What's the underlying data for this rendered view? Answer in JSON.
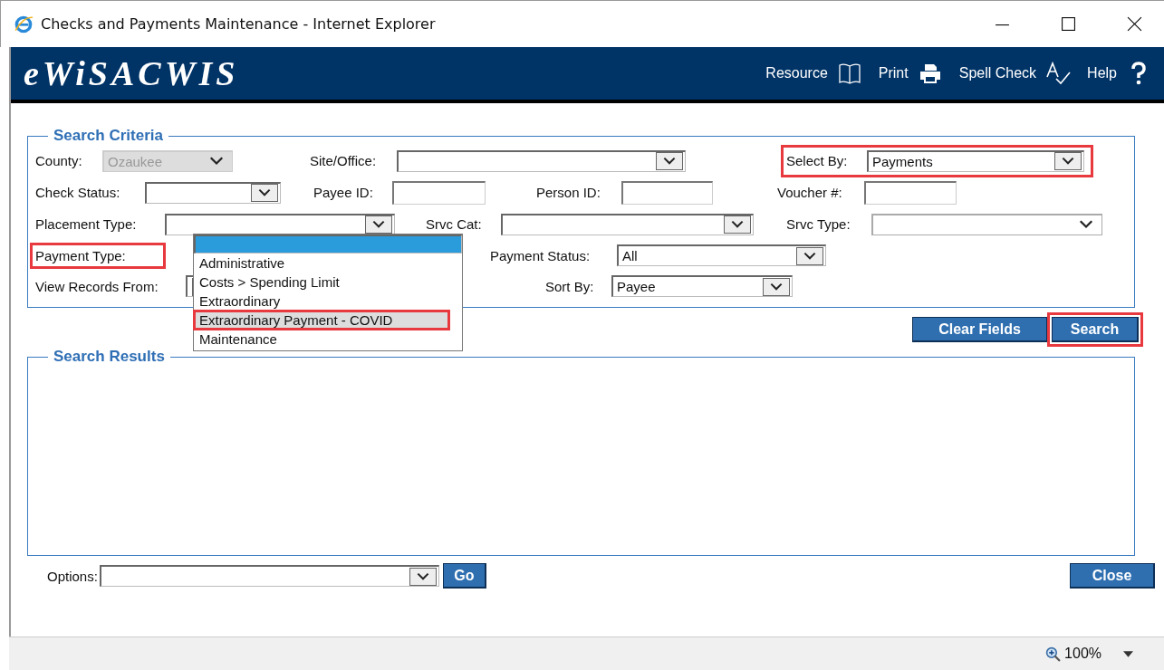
{
  "window": {
    "title": "Checks and Payments Maintenance - Internet Explorer"
  },
  "app": {
    "logo": "eWiSACWIS",
    "nav": [
      {
        "label": "Resource"
      },
      {
        "label": "Print"
      },
      {
        "label": "Spell Check"
      },
      {
        "label": "Help"
      }
    ]
  },
  "search_criteria": {
    "legend": "Search Criteria",
    "rows": [
      [
        {
          "label": "County:",
          "kind": "select",
          "value": "Ozaukee",
          "disabled": true,
          "highlighted": false
        },
        {
          "label": "Site/Office:",
          "kind": "select",
          "highlighted": false
        },
        {
          "label": "Select By:",
          "kind": "select",
          "value": "Payments",
          "highlighted": true
        }
      ],
      [
        {
          "label": "Check Status:",
          "kind": "select",
          "highlighted": false
        },
        {
          "label": "Payee ID:",
          "kind": "text",
          "highlighted": false
        },
        {
          "label": "Person ID:",
          "kind": "text",
          "highlighted": false
        },
        {
          "label": "Voucher #:",
          "kind": "text",
          "highlighted": false
        }
      ],
      [
        {
          "label": "Placement Type:",
          "kind": "select",
          "highlighted": false
        },
        {
          "label": "Srvc Cat:",
          "kind": "select",
          "highlighted": false
        },
        {
          "label": "Srvc Type:",
          "kind": "flatselect",
          "highlighted": false
        }
      ],
      [
        {
          "label": "Payment Type:",
          "kind": "open",
          "highlighted": true
        },
        {
          "label": "Payment Status:",
          "kind": "select",
          "value": "All",
          "highlighted": false
        }
      ],
      [
        {
          "label": "View Records From:",
          "kind": "select",
          "highlighted": false
        },
        {
          "label": "Sort By:",
          "kind": "select",
          "value": "Payee",
          "highlighted": false
        }
      ]
    ]
  },
  "dropdown_options": [
    {
      "selected": true,
      "hovered": false,
      "highlighted": false
    },
    {
      "label": "Administrative",
      "selected": false,
      "hovered": false,
      "highlighted": false
    },
    {
      "label": "Costs > Spending Limit",
      "selected": false,
      "hovered": false,
      "highlighted": false
    },
    {
      "label": "Extraordinary",
      "selected": false,
      "hovered": false,
      "highlighted": false
    },
    {
      "label": "Extraordinary Payment - COVID",
      "selected": false,
      "hovered": true,
      "highlighted": true
    },
    {
      "label": "Maintenance",
      "selected": false,
      "hovered": false,
      "highlighted": false
    }
  ],
  "actions": [
    {
      "label": "Clear Fields",
      "highlighted": false
    },
    {
      "label": "Search",
      "highlighted": true
    }
  ],
  "search_results": {
    "legend": "Search Results"
  },
  "options": {
    "label": "Options:",
    "go": "Go"
  },
  "close_button": "Close",
  "status_bar": {
    "zoom": "100%"
  }
}
